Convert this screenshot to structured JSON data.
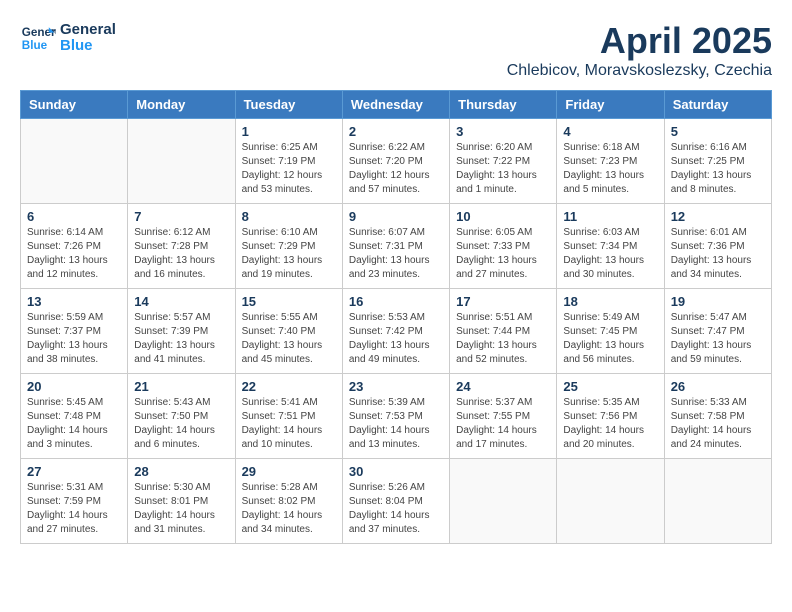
{
  "header": {
    "logo_line1": "General",
    "logo_line2": "Blue",
    "title": "April 2025",
    "subtitle": "Chlebicov, Moravskoslezsky, Czechia"
  },
  "weekdays": [
    "Sunday",
    "Monday",
    "Tuesday",
    "Wednesday",
    "Thursday",
    "Friday",
    "Saturday"
  ],
  "weeks": [
    [
      {
        "day": "",
        "info": ""
      },
      {
        "day": "",
        "info": ""
      },
      {
        "day": "1",
        "info": "Sunrise: 6:25 AM\nSunset: 7:19 PM\nDaylight: 12 hours\nand 53 minutes."
      },
      {
        "day": "2",
        "info": "Sunrise: 6:22 AM\nSunset: 7:20 PM\nDaylight: 12 hours\nand 57 minutes."
      },
      {
        "day": "3",
        "info": "Sunrise: 6:20 AM\nSunset: 7:22 PM\nDaylight: 13 hours\nand 1 minute."
      },
      {
        "day": "4",
        "info": "Sunrise: 6:18 AM\nSunset: 7:23 PM\nDaylight: 13 hours\nand 5 minutes."
      },
      {
        "day": "5",
        "info": "Sunrise: 6:16 AM\nSunset: 7:25 PM\nDaylight: 13 hours\nand 8 minutes."
      }
    ],
    [
      {
        "day": "6",
        "info": "Sunrise: 6:14 AM\nSunset: 7:26 PM\nDaylight: 13 hours\nand 12 minutes."
      },
      {
        "day": "7",
        "info": "Sunrise: 6:12 AM\nSunset: 7:28 PM\nDaylight: 13 hours\nand 16 minutes."
      },
      {
        "day": "8",
        "info": "Sunrise: 6:10 AM\nSunset: 7:29 PM\nDaylight: 13 hours\nand 19 minutes."
      },
      {
        "day": "9",
        "info": "Sunrise: 6:07 AM\nSunset: 7:31 PM\nDaylight: 13 hours\nand 23 minutes."
      },
      {
        "day": "10",
        "info": "Sunrise: 6:05 AM\nSunset: 7:33 PM\nDaylight: 13 hours\nand 27 minutes."
      },
      {
        "day": "11",
        "info": "Sunrise: 6:03 AM\nSunset: 7:34 PM\nDaylight: 13 hours\nand 30 minutes."
      },
      {
        "day": "12",
        "info": "Sunrise: 6:01 AM\nSunset: 7:36 PM\nDaylight: 13 hours\nand 34 minutes."
      }
    ],
    [
      {
        "day": "13",
        "info": "Sunrise: 5:59 AM\nSunset: 7:37 PM\nDaylight: 13 hours\nand 38 minutes."
      },
      {
        "day": "14",
        "info": "Sunrise: 5:57 AM\nSunset: 7:39 PM\nDaylight: 13 hours\nand 41 minutes."
      },
      {
        "day": "15",
        "info": "Sunrise: 5:55 AM\nSunset: 7:40 PM\nDaylight: 13 hours\nand 45 minutes."
      },
      {
        "day": "16",
        "info": "Sunrise: 5:53 AM\nSunset: 7:42 PM\nDaylight: 13 hours\nand 49 minutes."
      },
      {
        "day": "17",
        "info": "Sunrise: 5:51 AM\nSunset: 7:44 PM\nDaylight: 13 hours\nand 52 minutes."
      },
      {
        "day": "18",
        "info": "Sunrise: 5:49 AM\nSunset: 7:45 PM\nDaylight: 13 hours\nand 56 minutes."
      },
      {
        "day": "19",
        "info": "Sunrise: 5:47 AM\nSunset: 7:47 PM\nDaylight: 13 hours\nand 59 minutes."
      }
    ],
    [
      {
        "day": "20",
        "info": "Sunrise: 5:45 AM\nSunset: 7:48 PM\nDaylight: 14 hours\nand 3 minutes."
      },
      {
        "day": "21",
        "info": "Sunrise: 5:43 AM\nSunset: 7:50 PM\nDaylight: 14 hours\nand 6 minutes."
      },
      {
        "day": "22",
        "info": "Sunrise: 5:41 AM\nSunset: 7:51 PM\nDaylight: 14 hours\nand 10 minutes."
      },
      {
        "day": "23",
        "info": "Sunrise: 5:39 AM\nSunset: 7:53 PM\nDaylight: 14 hours\nand 13 minutes."
      },
      {
        "day": "24",
        "info": "Sunrise: 5:37 AM\nSunset: 7:55 PM\nDaylight: 14 hours\nand 17 minutes."
      },
      {
        "day": "25",
        "info": "Sunrise: 5:35 AM\nSunset: 7:56 PM\nDaylight: 14 hours\nand 20 minutes."
      },
      {
        "day": "26",
        "info": "Sunrise: 5:33 AM\nSunset: 7:58 PM\nDaylight: 14 hours\nand 24 minutes."
      }
    ],
    [
      {
        "day": "27",
        "info": "Sunrise: 5:31 AM\nSunset: 7:59 PM\nDaylight: 14 hours\nand 27 minutes."
      },
      {
        "day": "28",
        "info": "Sunrise: 5:30 AM\nSunset: 8:01 PM\nDaylight: 14 hours\nand 31 minutes."
      },
      {
        "day": "29",
        "info": "Sunrise: 5:28 AM\nSunset: 8:02 PM\nDaylight: 14 hours\nand 34 minutes."
      },
      {
        "day": "30",
        "info": "Sunrise: 5:26 AM\nSunset: 8:04 PM\nDaylight: 14 hours\nand 37 minutes."
      },
      {
        "day": "",
        "info": ""
      },
      {
        "day": "",
        "info": ""
      },
      {
        "day": "",
        "info": ""
      }
    ]
  ]
}
